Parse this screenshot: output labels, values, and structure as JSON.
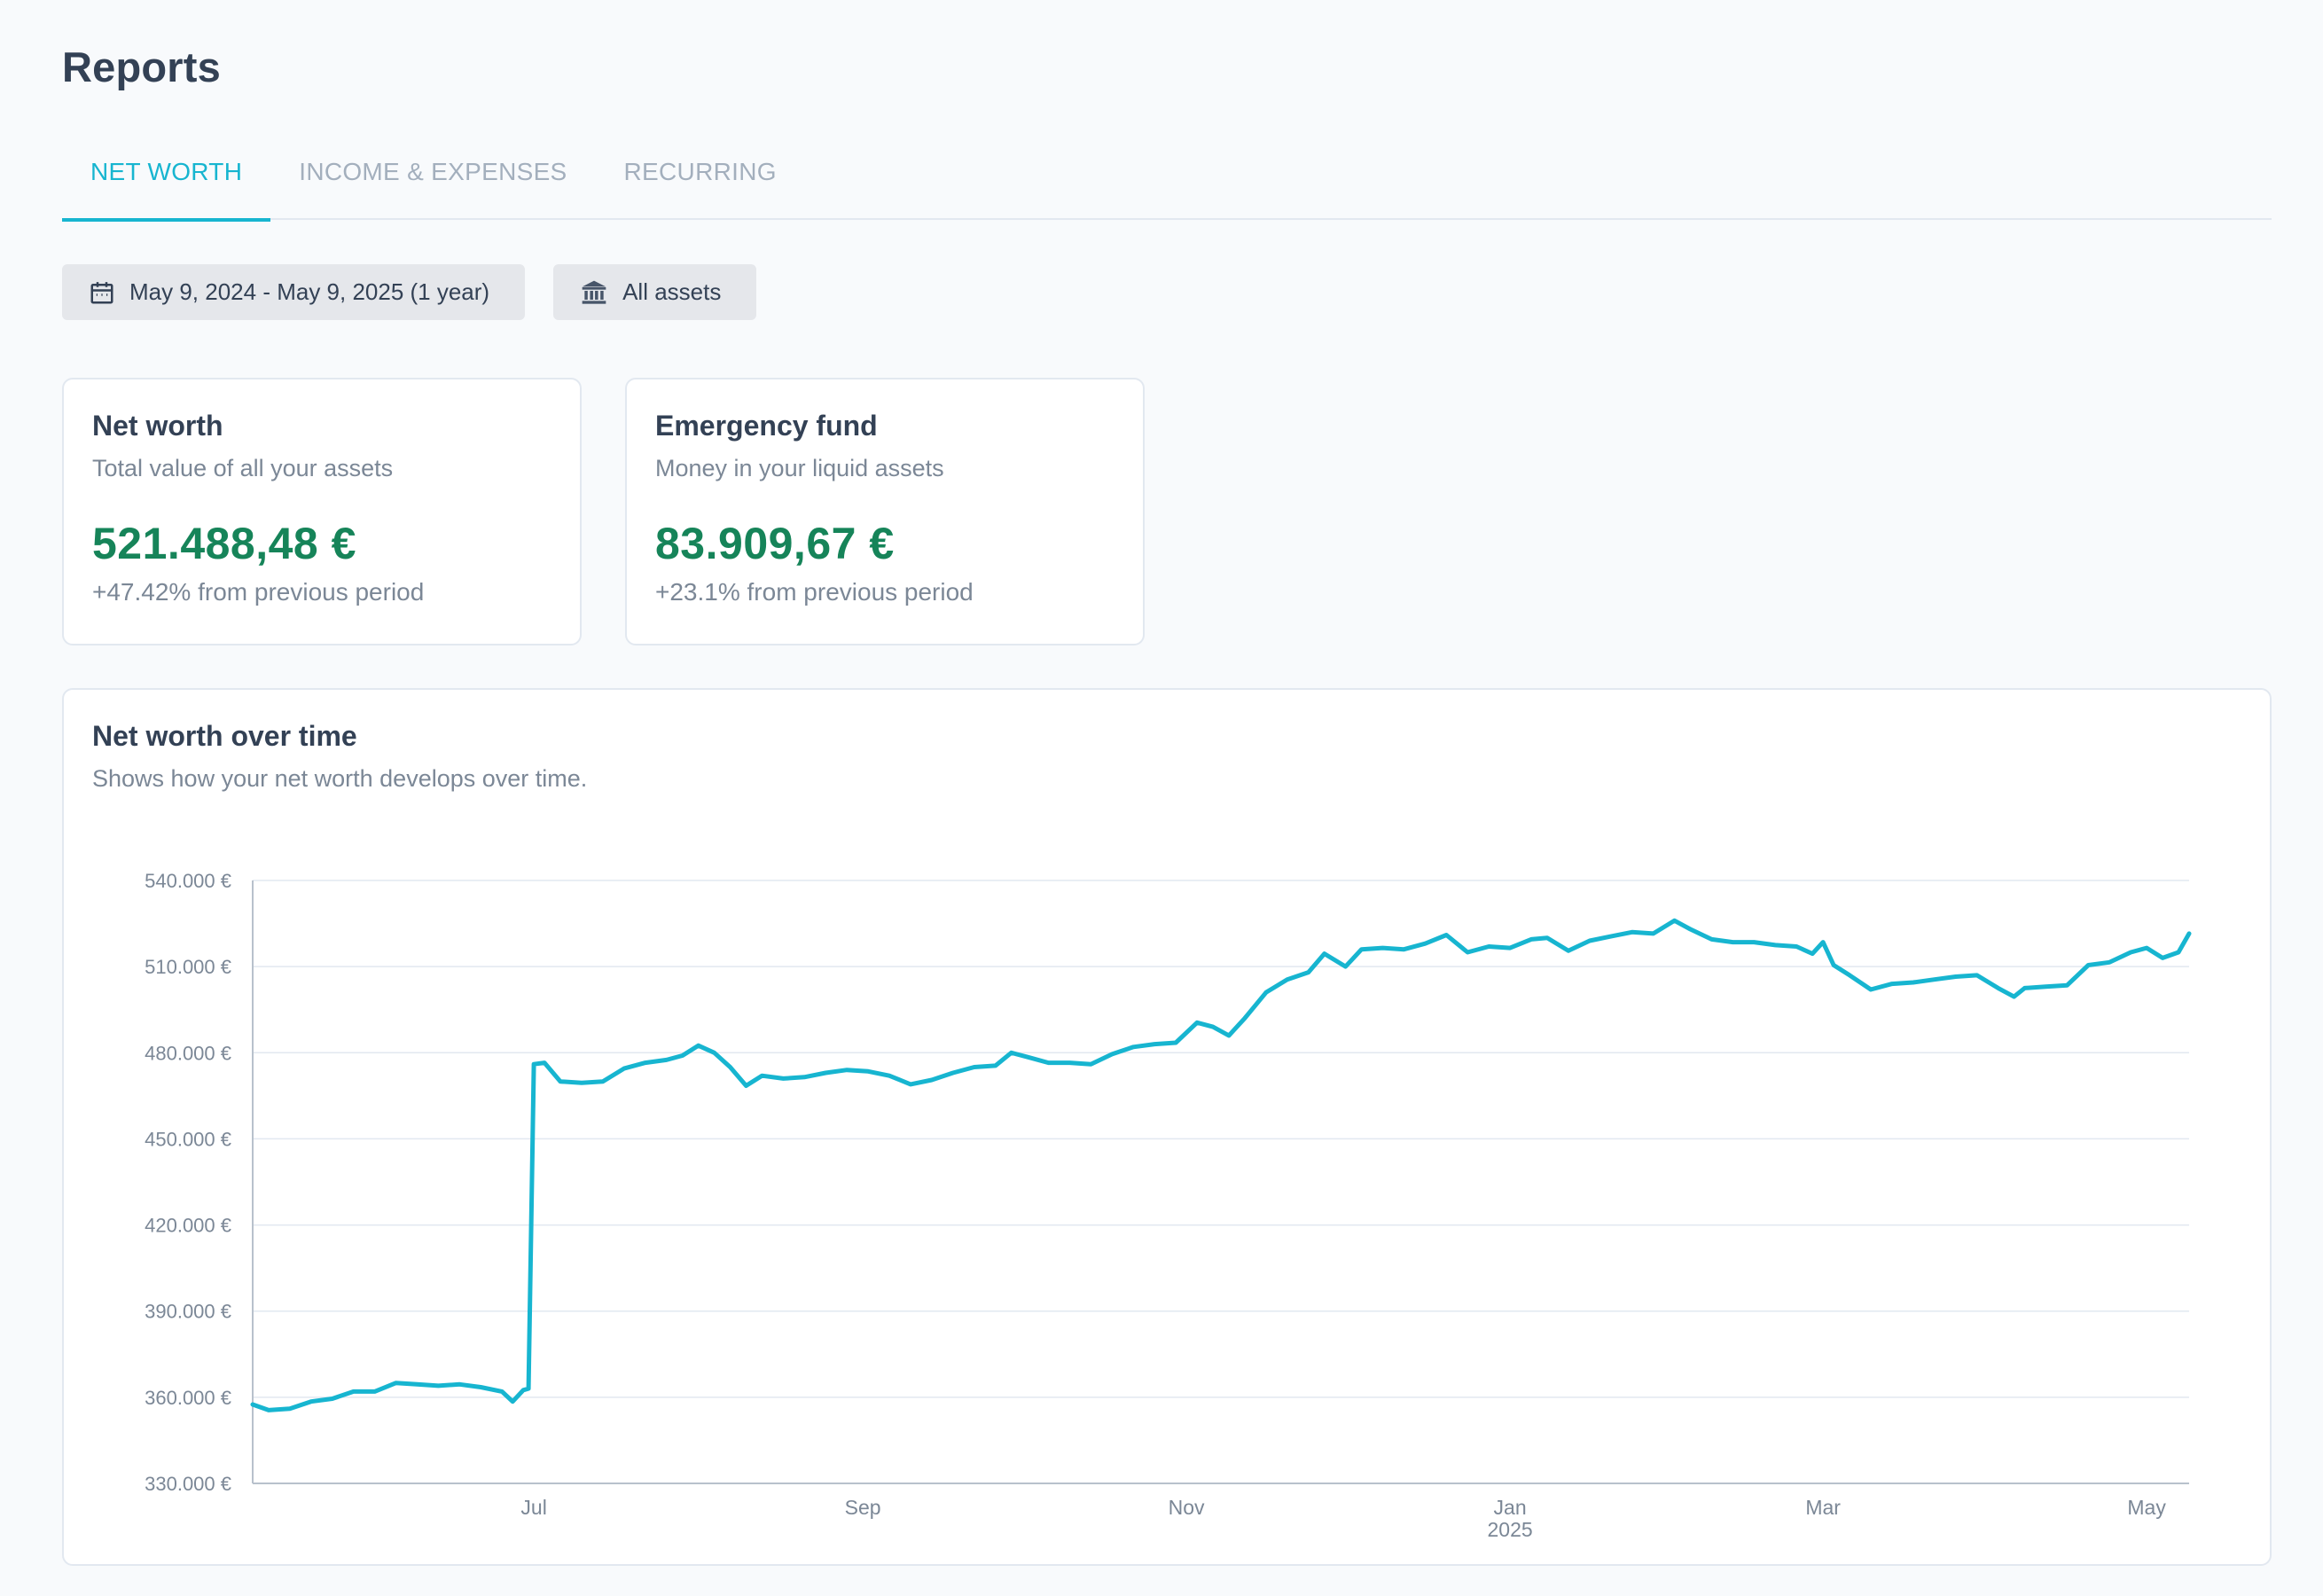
{
  "page": {
    "title": "Reports"
  },
  "tabs": [
    {
      "label": "NET WORTH",
      "active": true
    },
    {
      "label": "INCOME & EXPENSES",
      "active": false
    },
    {
      "label": "RECURRING",
      "active": false
    }
  ],
  "filters": {
    "date_range": {
      "label": "May 9, 2024 - May 9, 2025 (1 year)",
      "icon": "calendar-icon"
    },
    "assets": {
      "label": "All assets",
      "icon": "bank-icon"
    }
  },
  "cards": {
    "net_worth": {
      "title": "Net worth",
      "subtitle": "Total value of all your assets",
      "value": "521.488,48 €",
      "delta": "+47.42% from previous period"
    },
    "emergency_fund": {
      "title": "Emergency fund",
      "subtitle": "Money in your liquid assets",
      "value": "83.909,67 €",
      "delta": "+23.1% from previous period"
    }
  },
  "chart": {
    "title": "Net worth over time",
    "subtitle": "Shows how your net worth develops over time."
  },
  "colors": {
    "accent": "#17b5d0",
    "positive": "#168459",
    "line": "#17b5d0",
    "grid": "#e2e8f0",
    "muted": "#7b8796"
  },
  "chart_data": {
    "type": "line",
    "title": "Net worth over time",
    "subtitle": "Shows how your net worth develops over time.",
    "xlabel": "",
    "ylabel": "",
    "x_range": [
      "2024-05-09",
      "2025-05-09"
    ],
    "ylim": [
      330000,
      540000
    ],
    "y_ticks": [
      330000,
      360000,
      390000,
      420000,
      450000,
      480000,
      510000,
      540000
    ],
    "y_tick_labels": [
      "330.000 €",
      "360.000 €",
      "390.000 €",
      "420.000 €",
      "450.000 €",
      "480.000 €",
      "510.000 €",
      "540.000 €"
    ],
    "x_ticks": [
      {
        "date": "2024-07-01",
        "label": "Jul",
        "sublabel": ""
      },
      {
        "date": "2024-09-01",
        "label": "Sep",
        "sublabel": ""
      },
      {
        "date": "2024-11-01",
        "label": "Nov",
        "sublabel": ""
      },
      {
        "date": "2025-01-01",
        "label": "Jan",
        "sublabel": "2025"
      },
      {
        "date": "2025-03-01",
        "label": "Mar",
        "sublabel": ""
      },
      {
        "date": "2025-05-01",
        "label": "May",
        "sublabel": ""
      }
    ],
    "grid": true,
    "legend": "none",
    "series": [
      {
        "points": [
          [
            "2024-05-09",
            357500
          ],
          [
            "2024-05-12",
            355500
          ],
          [
            "2024-05-16",
            356000
          ],
          [
            "2024-05-20",
            358500
          ],
          [
            "2024-05-24",
            359500
          ],
          [
            "2024-05-28",
            362000
          ],
          [
            "2024-06-01",
            362000
          ],
          [
            "2024-06-05",
            365000
          ],
          [
            "2024-06-09",
            364500
          ],
          [
            "2024-06-13",
            364000
          ],
          [
            "2024-06-17",
            364500
          ],
          [
            "2024-06-21",
            363500
          ],
          [
            "2024-06-25",
            362000
          ],
          [
            "2024-06-27",
            358500
          ],
          [
            "2024-06-29",
            362500
          ],
          [
            "2024-06-30",
            363000
          ],
          [
            "2024-07-01",
            476000
          ],
          [
            "2024-07-03",
            476500
          ],
          [
            "2024-07-06",
            470000
          ],
          [
            "2024-07-10",
            469500
          ],
          [
            "2024-07-14",
            470000
          ],
          [
            "2024-07-18",
            474500
          ],
          [
            "2024-07-22",
            476500
          ],
          [
            "2024-07-26",
            477500
          ],
          [
            "2024-07-29",
            479000
          ],
          [
            "2024-08-01",
            482500
          ],
          [
            "2024-08-04",
            480000
          ],
          [
            "2024-08-07",
            475000
          ],
          [
            "2024-08-10",
            468500
          ],
          [
            "2024-08-13",
            472000
          ],
          [
            "2024-08-17",
            471000
          ],
          [
            "2024-08-21",
            471500
          ],
          [
            "2024-08-25",
            473000
          ],
          [
            "2024-08-29",
            474000
          ],
          [
            "2024-09-02",
            473500
          ],
          [
            "2024-09-06",
            472000
          ],
          [
            "2024-09-10",
            469000
          ],
          [
            "2024-09-14",
            470500
          ],
          [
            "2024-09-18",
            473000
          ],
          [
            "2024-09-22",
            475000
          ],
          [
            "2024-09-26",
            475500
          ],
          [
            "2024-09-29",
            480000
          ],
          [
            "2024-10-02",
            478500
          ],
          [
            "2024-10-06",
            476500
          ],
          [
            "2024-10-10",
            476500
          ],
          [
            "2024-10-14",
            476000
          ],
          [
            "2024-10-18",
            479500
          ],
          [
            "2024-10-22",
            482000
          ],
          [
            "2024-10-26",
            483000
          ],
          [
            "2024-10-30",
            483500
          ],
          [
            "2024-11-03",
            490500
          ],
          [
            "2024-11-06",
            489000
          ],
          [
            "2024-11-09",
            486000
          ],
          [
            "2024-11-12",
            492000
          ],
          [
            "2024-11-16",
            501000
          ],
          [
            "2024-11-20",
            505500
          ],
          [
            "2024-11-24",
            508000
          ],
          [
            "2024-11-27",
            514500
          ],
          [
            "2024-12-01",
            510000
          ],
          [
            "2024-12-04",
            516000
          ],
          [
            "2024-12-08",
            516500
          ],
          [
            "2024-12-12",
            516000
          ],
          [
            "2024-12-16",
            518000
          ],
          [
            "2024-12-20",
            521000
          ],
          [
            "2024-12-24",
            515000
          ],
          [
            "2024-12-28",
            517000
          ],
          [
            "2025-01-01",
            516500
          ],
          [
            "2025-01-05",
            519500
          ],
          [
            "2025-01-08",
            520000
          ],
          [
            "2025-01-12",
            515500
          ],
          [
            "2025-01-16",
            519000
          ],
          [
            "2025-01-20",
            520500
          ],
          [
            "2025-01-24",
            522000
          ],
          [
            "2025-01-28",
            521500
          ],
          [
            "2025-02-01",
            526000
          ],
          [
            "2025-02-04",
            523000
          ],
          [
            "2025-02-08",
            519500
          ],
          [
            "2025-02-12",
            518500
          ],
          [
            "2025-02-16",
            518500
          ],
          [
            "2025-02-20",
            517500
          ],
          [
            "2025-02-24",
            517000
          ],
          [
            "2025-02-27",
            514500
          ],
          [
            "2025-03-01",
            518500
          ],
          [
            "2025-03-03",
            510500
          ],
          [
            "2025-03-06",
            507000
          ],
          [
            "2025-03-10",
            502000
          ],
          [
            "2025-03-14",
            504000
          ],
          [
            "2025-03-18",
            504500
          ],
          [
            "2025-03-22",
            505500
          ],
          [
            "2025-03-26",
            506500
          ],
          [
            "2025-03-30",
            507000
          ],
          [
            "2025-04-03",
            502500
          ],
          [
            "2025-04-06",
            499500
          ],
          [
            "2025-04-08",
            502500
          ],
          [
            "2025-04-12",
            503000
          ],
          [
            "2025-04-16",
            503500
          ],
          [
            "2025-04-20",
            510500
          ],
          [
            "2025-04-24",
            511500
          ],
          [
            "2025-04-28",
            515000
          ],
          [
            "2025-05-01",
            516500
          ],
          [
            "2025-05-04",
            513000
          ],
          [
            "2025-05-07",
            515000
          ],
          [
            "2025-05-09",
            521500
          ]
        ]
      }
    ]
  }
}
